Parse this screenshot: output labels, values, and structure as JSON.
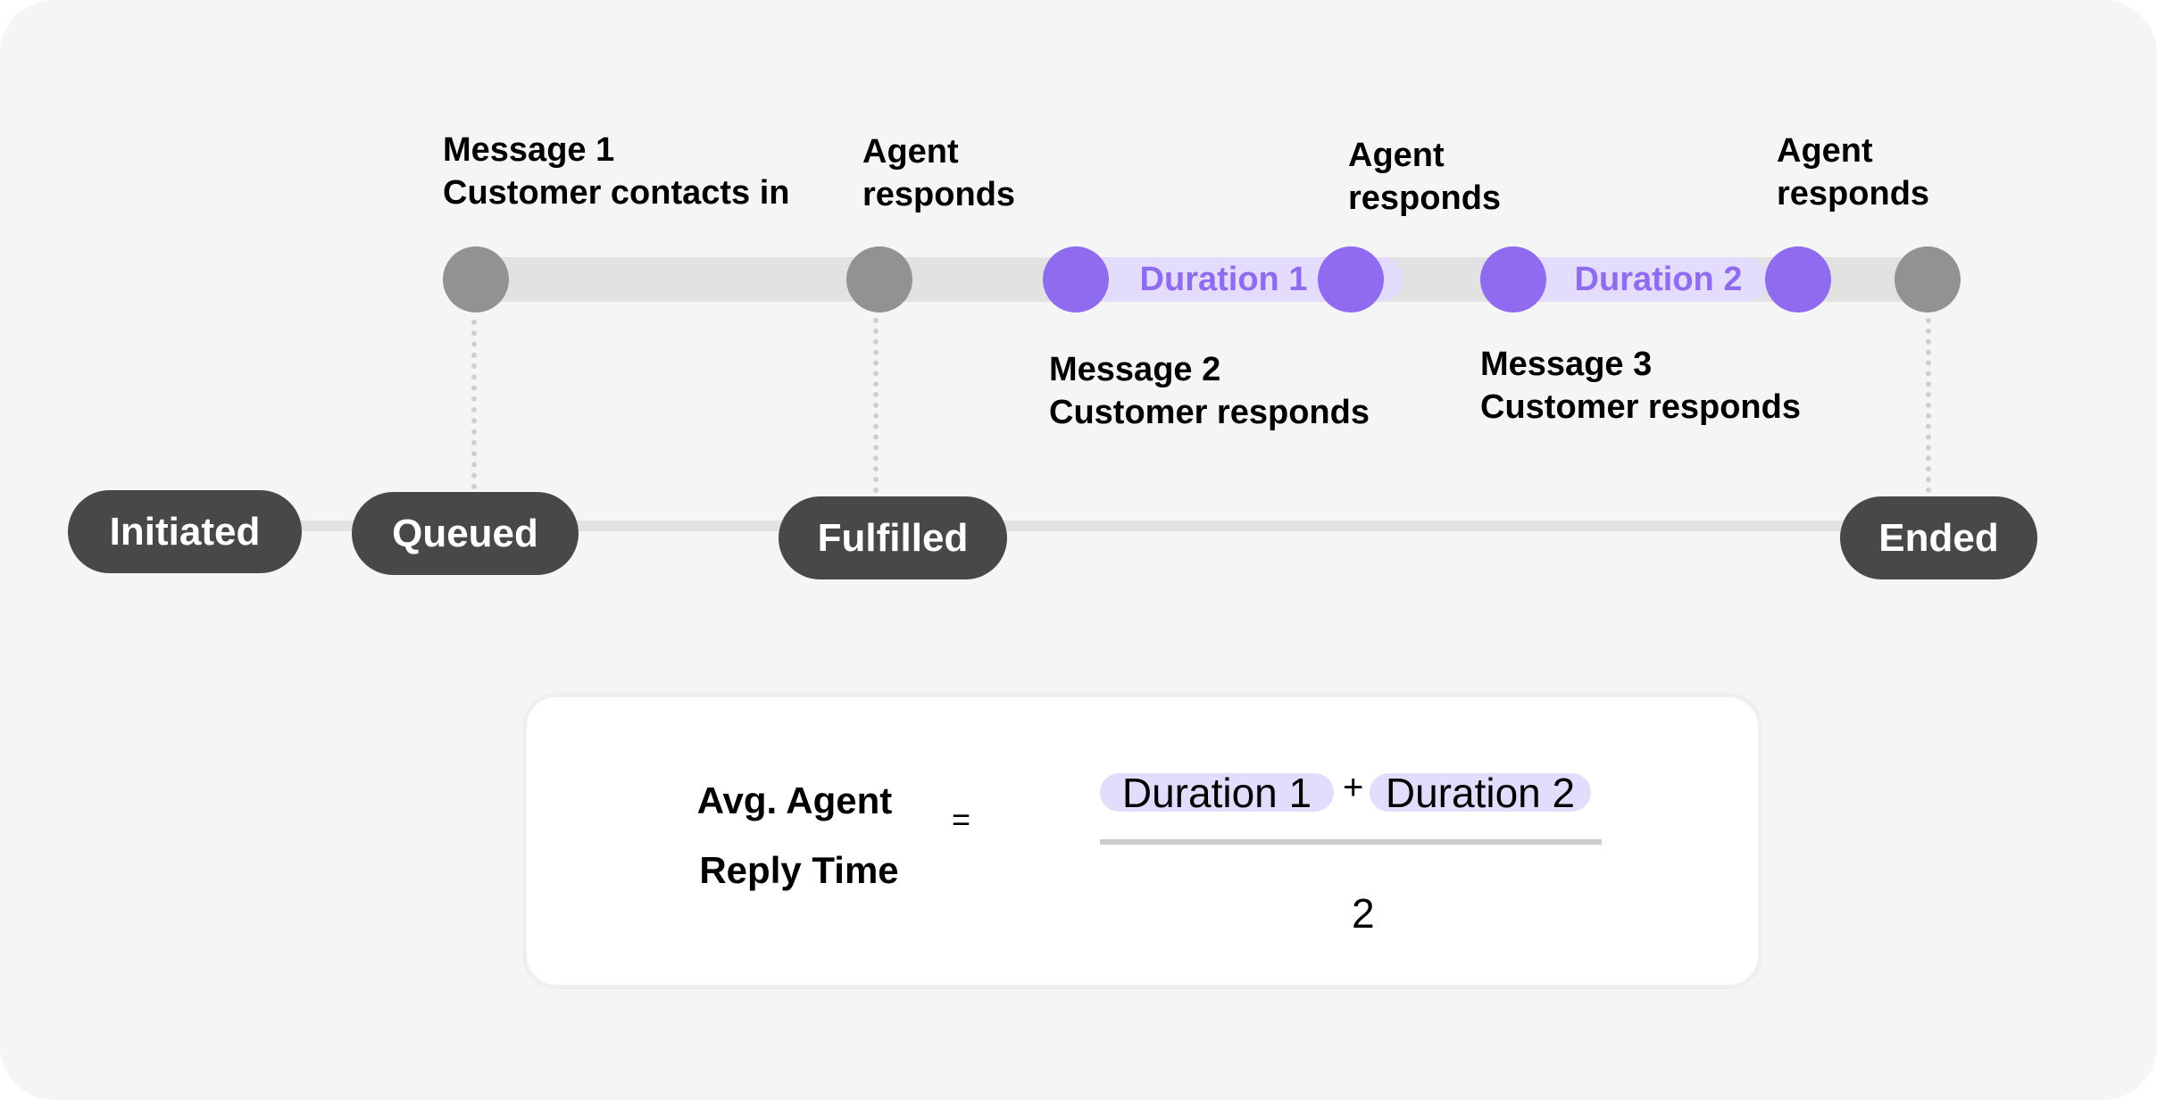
{
  "colors": {
    "background": "#f5f5f5",
    "track": "#e2e2e2",
    "event_gray": "#929292",
    "event_purple": "#8f6bef",
    "duration_highlight": "#e4dcfd",
    "status_pill": "#484848",
    "fraction_line": "#cccccc"
  },
  "top_labels": [
    {
      "line1": "Message 1",
      "line2": "Customer contacts in"
    },
    {
      "line1": "Agent",
      "line2": "responds"
    },
    {
      "line1": "Agent",
      "line2": "responds"
    },
    {
      "line1": "Agent",
      "line2": "responds"
    }
  ],
  "bottom_labels": [
    {
      "line1": "Message 2",
      "line2": "Customer responds"
    },
    {
      "line1": "Message 3",
      "line2": "Customer responds"
    }
  ],
  "durations": [
    "Duration 1",
    "Duration 2"
  ],
  "statuses": [
    "Initiated",
    "Queued",
    "Fulfilled",
    "Ended"
  ],
  "formula": {
    "lhs_line1": "Avg. Agent",
    "lhs_line2": "Reply Time",
    "equals": "=",
    "numerator_terms": [
      "Duration 1",
      "Duration 2"
    ],
    "operator": "+",
    "denominator": "2"
  }
}
